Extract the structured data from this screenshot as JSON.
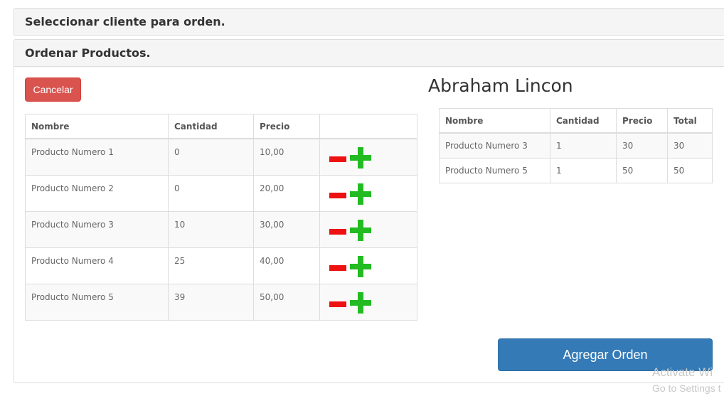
{
  "panels": {
    "select_client_title": "Seleccionar cliente para orden.",
    "order_products_title": "Ordenar Productos."
  },
  "cancel_label": "Cancelar",
  "client_name": "Abraham Lincon",
  "product_table": {
    "headers": [
      "Nombre",
      "Cantidad",
      "Precio",
      ""
    ],
    "rows": [
      {
        "nombre": "Producto Numero 1",
        "cantidad": "0",
        "precio": "10,00"
      },
      {
        "nombre": "Producto Numero 2",
        "cantidad": "0",
        "precio": "20,00"
      },
      {
        "nombre": "Producto Numero 3",
        "cantidad": "10",
        "precio": "30,00"
      },
      {
        "nombre": "Producto Numero 4",
        "cantidad": "25",
        "precio": "40,00"
      },
      {
        "nombre": "Producto Numero 5",
        "cantidad": "39",
        "precio": "50,00"
      }
    ]
  },
  "order_table": {
    "headers": [
      "Nombre",
      "Cantidad",
      "Precio",
      "Total"
    ],
    "rows": [
      {
        "nombre": "Producto Numero 3",
        "cantidad": "1",
        "precio": "30",
        "total": "30"
      },
      {
        "nombre": "Producto Numero 5",
        "cantidad": "1",
        "precio": "50",
        "total": "50"
      }
    ]
  },
  "add_order_label": "Agregar Orden",
  "watermark": {
    "line1": "Activate Wi",
    "line2": "Go to Settings t"
  },
  "colors": {
    "danger": "#d9534f",
    "primary": "#337ab7",
    "minus": "#ee1111",
    "plus": "#22bb22"
  }
}
